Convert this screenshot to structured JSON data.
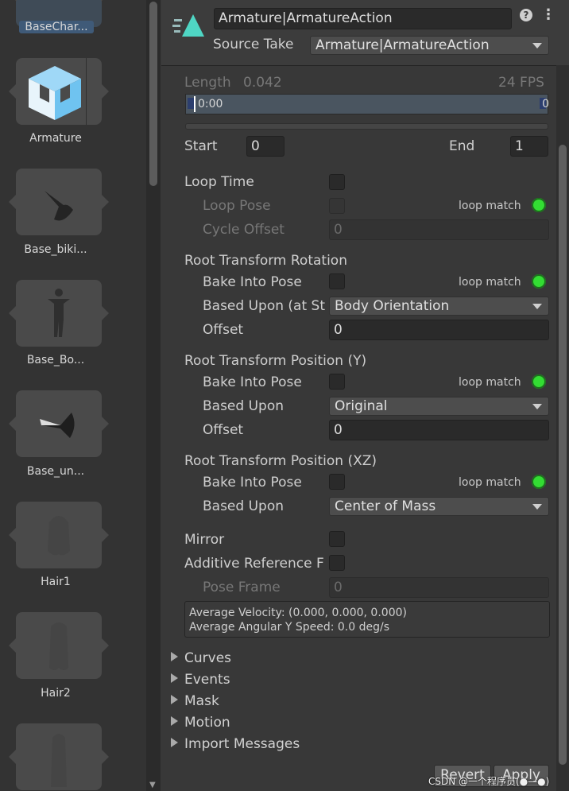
{
  "project": {
    "assets": [
      {
        "label": "BaseChar...",
        "icon": "prefab-icon"
      },
      {
        "label": "Armature",
        "icon": "model-prefab-icon"
      },
      {
        "label": "Base_biki...",
        "icon": "mesh-preview-icon"
      },
      {
        "label": "Base_Bo...",
        "icon": "mesh-preview-icon"
      },
      {
        "label": "Base_un...",
        "icon": "mesh-preview-icon"
      },
      {
        "label": "Hair1",
        "icon": "mesh-preview-icon"
      },
      {
        "label": "Hair2",
        "icon": "mesh-preview-icon"
      },
      {
        "label": "",
        "icon": "mesh-preview-icon"
      }
    ]
  },
  "header": {
    "clip_name": "Armature|ArmatureAction",
    "source_take_label": "Source Take",
    "source_take_value": "Armature|ArmatureAction",
    "help_icon": "?",
    "menu_icon": "⋮"
  },
  "timeline": {
    "length_label": "Length",
    "length_value": "0.042",
    "fps": "24 FPS",
    "time_marker": "0:00",
    "start_label": "Start",
    "start_value": "0",
    "end_label": "End",
    "end_value": "1"
  },
  "loop": {
    "loop_time_label": "Loop Time",
    "loop_pose_label": "Loop Pose",
    "loop_match": "loop match",
    "cycle_offset_label": "Cycle Offset",
    "cycle_offset_value": "0"
  },
  "root_rotation": {
    "title": "Root Transform Rotation",
    "bake_label": "Bake Into Pose",
    "loop_match": "loop match",
    "based_upon_label": "Based Upon (at St",
    "based_upon_value": "Body Orientation",
    "offset_label": "Offset",
    "offset_value": "0"
  },
  "root_pos_y": {
    "title": "Root Transform Position (Y)",
    "bake_label": "Bake Into Pose",
    "loop_match": "loop match",
    "based_upon_label": "Based Upon",
    "based_upon_value": "Original",
    "offset_label": "Offset",
    "offset_value": "0"
  },
  "root_pos_xz": {
    "title": "Root Transform Position (XZ)",
    "bake_label": "Bake Into Pose",
    "loop_match": "loop match",
    "based_upon_label": "Based Upon",
    "based_upon_value": "Center of Mass"
  },
  "misc": {
    "mirror_label": "Mirror",
    "additive_label": "Additive Reference F",
    "pose_frame_label": "Pose Frame",
    "pose_frame_value": "0",
    "avg_velocity": "Average Velocity: (0.000, 0.000, 0.000)",
    "avg_angular": "Average Angular Y Speed: 0.0 deg/s"
  },
  "foldouts": [
    "Curves",
    "Events",
    "Mask",
    "Motion",
    "Import Messages"
  ],
  "footer": {
    "revert": "Revert",
    "apply": "Apply",
    "watermark": "CSDN @一个程序员(●—●)"
  },
  "colors": {
    "loop_match_dot": "#33dd33",
    "clip_icon": "#4fd6c4"
  }
}
